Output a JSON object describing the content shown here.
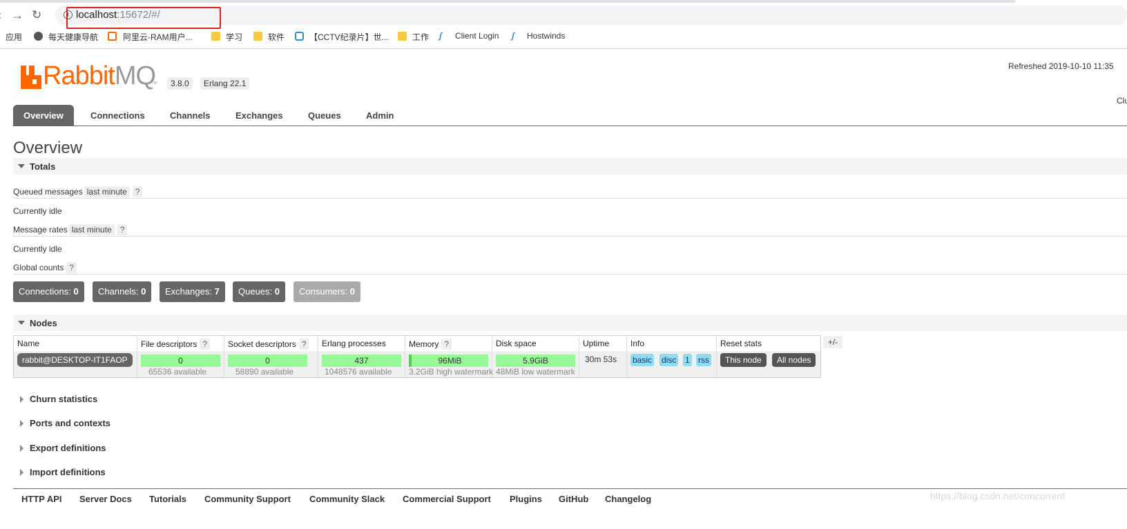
{
  "browser": {
    "url_host": "localhost",
    "url_rest": ":15672/#/",
    "bookmarks": [
      "应用",
      "每天健康导航",
      "阿里云-RAM用户...",
      "学习",
      "软件",
      "【CCTV纪录片】世...",
      "工作",
      "Client Login",
      "Hostwinds"
    ]
  },
  "header": {
    "logo_rabbit": "Rabbit",
    "logo_mq": "MQ",
    "logo_tm": "TM",
    "version": "3.8.0",
    "erlang": "Erlang 22.1",
    "refreshed": "Refreshed 2019-10-10 11:35",
    "cluster_partial": "Clu"
  },
  "tabs": [
    "Overview",
    "Connections",
    "Channels",
    "Exchanges",
    "Queues",
    "Admin"
  ],
  "page_title": "Overview",
  "totals": {
    "heading": "Totals",
    "queued_messages_label": "Queued messages",
    "queued_period": "last minute",
    "help": "?",
    "idle1": "Currently idle",
    "message_rates_label": "Message rates",
    "message_period": "last minute",
    "idle2": "Currently idle",
    "global_counts_label": "Global counts",
    "counts": [
      {
        "label": "Connections:",
        "value": "0"
      },
      {
        "label": "Channels:",
        "value": "0"
      },
      {
        "label": "Exchanges:",
        "value": "7"
      },
      {
        "label": "Queues:",
        "value": "0"
      },
      {
        "label": "Consumers:",
        "value": "0"
      }
    ]
  },
  "nodes": {
    "heading": "Nodes",
    "columns": [
      "Name",
      "File descriptors",
      "Socket descriptors",
      "Erlang processes",
      "Memory",
      "Disk space",
      "Uptime",
      "Info",
      "Reset stats"
    ],
    "plus_minus": "+/-",
    "row": {
      "name": "rabbit@DESKTOP-IT1FAOP",
      "file_desc": "0",
      "file_desc_avail": "65536 available",
      "socket_desc": "0",
      "socket_desc_avail": "58890 available",
      "erlang_proc": "437",
      "erlang_proc_avail": "1048576 available",
      "memory": "96MiB",
      "memory_watermark": "3.2GiB high watermark",
      "disk": "5.9GiB",
      "disk_watermark": "48MiB low watermark",
      "uptime": "30m 53s",
      "info_tags": [
        "basic",
        "disc",
        "1",
        "rss"
      ],
      "reset_this": "This node",
      "reset_all": "All nodes"
    }
  },
  "collapsed_sections": [
    "Churn statistics",
    "Ports and contexts",
    "Export definitions",
    "Import definitions"
  ],
  "footer_links": [
    "HTTP API",
    "Server Docs",
    "Tutorials",
    "Community Support",
    "Community Slack",
    "Commercial Support",
    "Plugins",
    "GitHub",
    "Changelog"
  ],
  "watermark": "https://blog.csdn.net/concurrent",
  "colors": {
    "brand_orange": "#ff6600",
    "tab_active": "#666666",
    "bar_green": "#98f898",
    "tag_blue": "#8fdbf2",
    "highlight_red": "#e02020"
  }
}
